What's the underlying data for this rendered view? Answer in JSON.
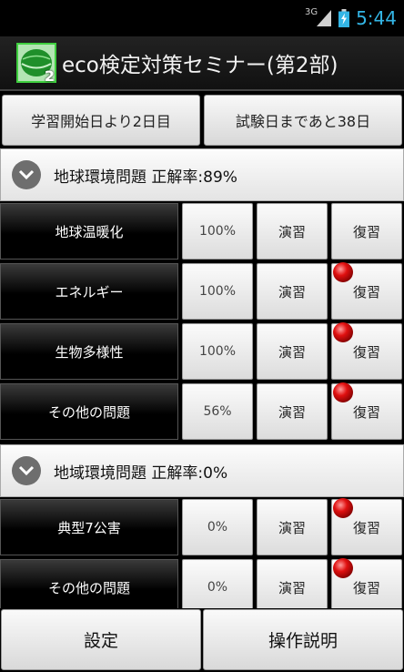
{
  "status_bar": {
    "network": "3G",
    "time": "5:44",
    "signal_icon": "signal-icon",
    "battery_icon": "battery-charging-icon"
  },
  "header": {
    "title": "eco検定対策セミナー(第2部)",
    "app_icon": "eco-app-icon",
    "badge": "2"
  },
  "info": {
    "study_days": "学習開始日より2日目",
    "exam_days": "試験日まであと38日"
  },
  "sections": [
    {
      "title": "地球環境問題 正解率:89%",
      "rows": [
        {
          "label": "地球温暖化",
          "percent": "100%",
          "practice": "演習",
          "review": "復習",
          "marked": false
        },
        {
          "label": "エネルギー",
          "percent": "100%",
          "practice": "演習",
          "review": "復習",
          "marked": true
        },
        {
          "label": "生物多様性",
          "percent": "100%",
          "practice": "演習",
          "review": "復習",
          "marked": true
        },
        {
          "label": "その他の問題",
          "percent": "56%",
          "practice": "演習",
          "review": "復習",
          "marked": true
        }
      ]
    },
    {
      "title": "地域環境問題 正解率:0%",
      "rows": [
        {
          "label": "典型7公害",
          "percent": "0%",
          "practice": "演習",
          "review": "復習",
          "marked": true
        },
        {
          "label": "その他の問題",
          "percent": "0%",
          "practice": "演習",
          "review": "復習",
          "marked": true
        }
      ]
    }
  ],
  "bottom": {
    "settings": "設定",
    "instructions": "操作説明"
  },
  "colors": {
    "clock": "#33b5e5",
    "icon_green": "#3fcf3f",
    "dot_red": "#e01010"
  }
}
